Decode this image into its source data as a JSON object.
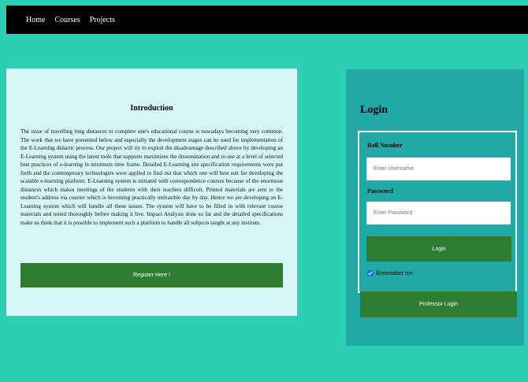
{
  "nav": {
    "items": [
      {
        "label": "Home"
      },
      {
        "label": "Courses"
      },
      {
        "label": "Projects"
      }
    ]
  },
  "intro": {
    "title": "Introduction",
    "text": "The issue of travelling long distances to complete one's educational course is nowadays becoming very common. The work that we have presented below and especially the development stages can be used for implementation of the E-Learning didactic process. Our project will try to exploit the disadvantage described above by developing an E-Learning system using the latest tools that supports maximizes the dissemination and re-use at a level of selected best practices of e-learning in minimum time frame. Detailed E-Learning site specification requirements were put forth and the contemporary technologies were applied to find out that which one will best suit for developing the scalable e-learning platform. E-Learning system is initiated with correspondence courses because of the enormous distances which makes meetings of the students with their teachers difficult. Printed materials are sent to the student's address via courier which is becoming practically unfeasible day by day. Hence we are developing an E-Learning system which will handle all these issues. The system will have to be filled in with relevant course materials and tested thoroughly before making it live. Impact Analysis done so far and the detailed specifications make us think that it is possible to implement such a platform to handle all subjects taught at any institute.",
    "register_label": "Register Here !"
  },
  "login": {
    "title": "Login",
    "roll_label": "Roll Number",
    "username_placeholder": "Enter Username",
    "password_label": "Password",
    "password_placeholder": "Enter Password",
    "login_label": "Login",
    "remember_label": "Remember me",
    "remember_checked": true,
    "professor_label": "Professor Login"
  }
}
